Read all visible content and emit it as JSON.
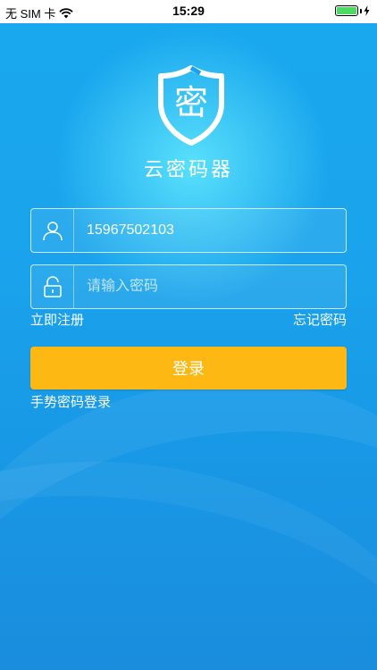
{
  "status_bar": {
    "carrier": "无 SIM 卡",
    "time": "15:29"
  },
  "app": {
    "logo_char": "密",
    "name": "云密码器"
  },
  "login_form": {
    "username_value": "15967502103",
    "password_placeholder": "请输入密码",
    "register_label": "立即注册",
    "forgot_label": "忘记密码",
    "login_label": "登录",
    "gesture_label": "手势密码登录"
  },
  "colors": {
    "background": "#1aa3ec",
    "button": "#fdb814",
    "text": "#ffffff"
  }
}
